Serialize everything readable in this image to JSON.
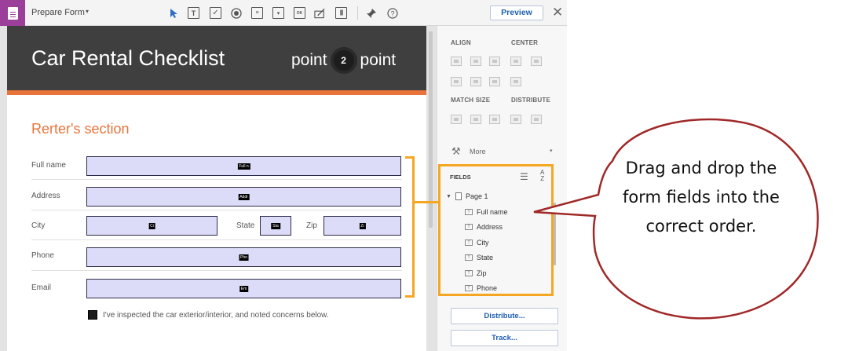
{
  "toolbar": {
    "tool_name": "Prepare Form",
    "caret": "▾",
    "icons": [
      "cursor-icon",
      "text-field-icon",
      "checkbox-icon",
      "radio-button-icon",
      "list-box-icon",
      "dropdown-icon",
      "button-icon",
      "signature-icon",
      "barcode-icon",
      "pin-icon",
      "help-icon"
    ],
    "preview_label": "Preview",
    "close_glyph": "✕"
  },
  "document": {
    "title": "Car Rental Checklist",
    "logo": {
      "left": "point",
      "center": "2",
      "right": "point"
    },
    "section_title": "Rerter's section",
    "fields": [
      {
        "label": "Full name",
        "tag": "Full n"
      },
      {
        "label": "Address",
        "tag": "Addr"
      },
      {
        "label": "City",
        "tag": "Ci"
      },
      {
        "label": "State",
        "tag": "Sta"
      },
      {
        "label": "Zip",
        "tag": "Zi"
      },
      {
        "label": "Phone",
        "tag": "Pho"
      },
      {
        "label": "Email",
        "tag": "Em"
      }
    ],
    "checkbox_label": "I've inspected the car exterior/interior, and noted concerns below."
  },
  "panel": {
    "align_label": "ALIGN",
    "center_label": "CENTER",
    "match_size_label": "MATCH SIZE",
    "distribute_label": "DISTRIBUTE",
    "more_label": "More",
    "fields_label": "FIELDS",
    "az_label": "A\nZ",
    "page_label": "Page 1",
    "field_list": [
      "Full name",
      "Address",
      "City",
      "State",
      "Zip",
      "Phone"
    ],
    "distribute_button": "Distribute...",
    "track_button": "Track..."
  },
  "callout": {
    "text": "Drag and drop the form fields into the correct order.",
    "colors": {
      "highlight": "#f5a623",
      "bubble_border": "#a02828"
    }
  }
}
